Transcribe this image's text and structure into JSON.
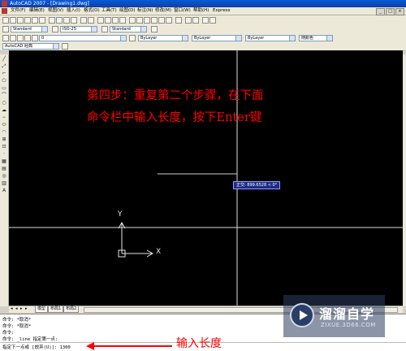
{
  "window": {
    "title": "AutoCAD 2007 - [Drawing1.dwg]",
    "controls": [
      "_",
      "□",
      "×"
    ]
  },
  "menu": {
    "items": [
      "文件(F)",
      "编辑(E)",
      "视图(V)",
      "插入(I)",
      "格式(O)",
      "工具(T)",
      "绘图(D)",
      "标注(N)",
      "修改(M)",
      "窗口(W)",
      "帮助(H)",
      "Express"
    ]
  },
  "toolbar": {
    "text_style": "Standard",
    "dim_style": "ISO-25",
    "table_style": "Standard",
    "workspace": "AutoCAD 经典",
    "layer": "0",
    "color": "ByLayer",
    "linetype": "ByLayer",
    "lineweight": "ByLayer",
    "plot_style": "随颜色"
  },
  "canvas": {
    "instruction_line1": "第四步：重复第二个步骤，在下面",
    "instruction_line2": "命令栏中输入长度，按下Enter键",
    "ucs_x_label": "X",
    "ucs_y_label": "Y",
    "tooltip": "正交: 899.6528 < 0°"
  },
  "tabs": [
    "模型",
    "布局1",
    "布局2"
  ],
  "command_line": {
    "lines": [
      "命令: *取消*",
      "命令: *取消*",
      "命令:",
      "命令: _line 指定第一点:"
    ],
    "prompt": "指定下一点或 [放弃(U)]: 1300",
    "annotation": "输入长度"
  },
  "watermark": {
    "name": "溜溜自学",
    "url": "ZIXUE.3D66.COM"
  },
  "colors": {
    "canvas_bg": "#000000",
    "instruction_red": "#ff0000",
    "crosshair": "#ffffff",
    "titlebar_blue": "#0a5bd6"
  }
}
